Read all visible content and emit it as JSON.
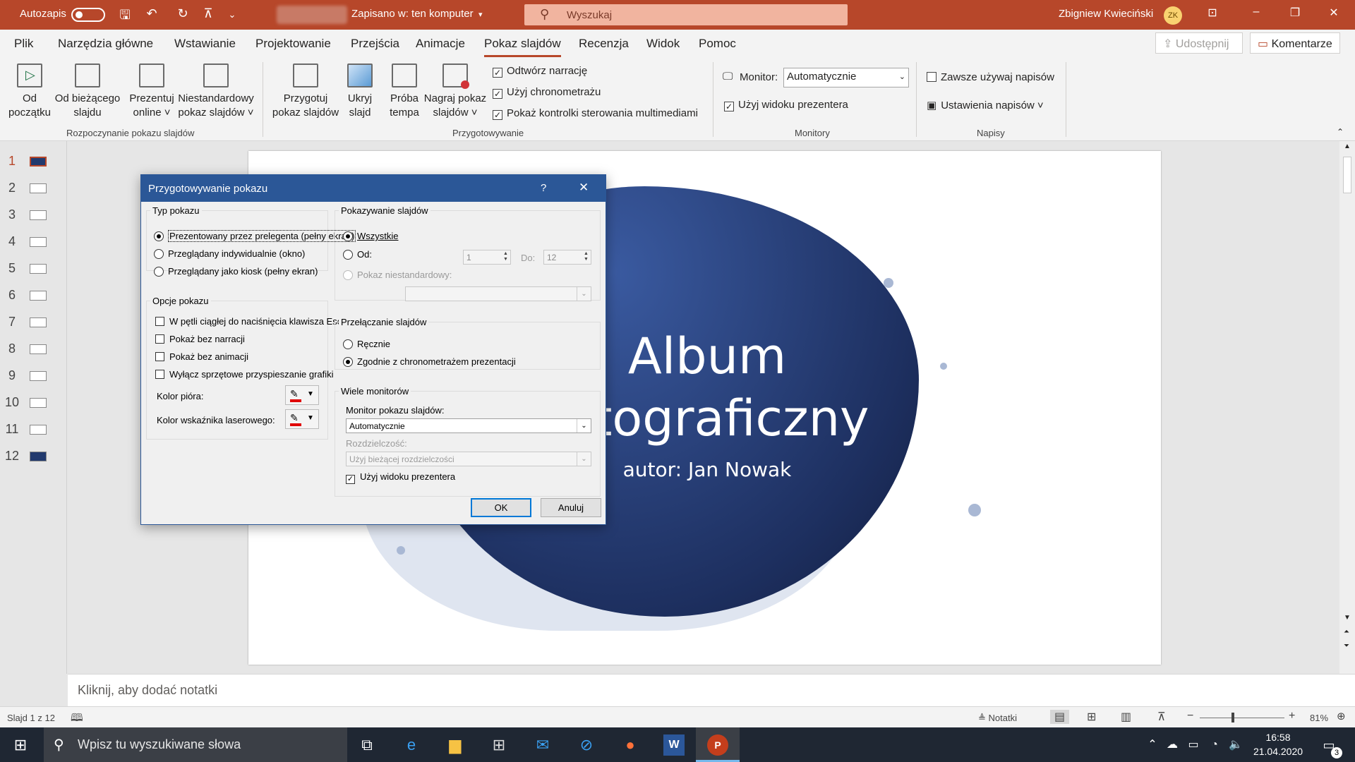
{
  "titlebar": {
    "autosave": "Autozapis",
    "save_state": "Zapisano w: ten komputer",
    "search_placeholder": "Wyszukaj",
    "user": "Zbigniew Kwieciński",
    "initials": "ZK"
  },
  "tabs": [
    "Plik",
    "Narzędzia główne",
    "Wstawianie",
    "Projektowanie",
    "Przejścia",
    "Animacje",
    "Pokaz slajdów",
    "Recenzja",
    "Widok",
    "Pomoc"
  ],
  "share_label": "Udostępnij",
  "comments_label": "Komentarze",
  "ribbon": {
    "from_start": [
      "Od",
      "początku"
    ],
    "from_current": [
      "Od bieżącego",
      "slajdu"
    ],
    "present_online": [
      "Prezentuj",
      "online ˅"
    ],
    "custom_show": [
      "Niestandardowy",
      "pokaz slajdów ˅"
    ],
    "group_start": "Rozpoczynanie pokazu slajdów",
    "setup_show": [
      "Przygotuj",
      "pokaz slajdów"
    ],
    "hide_slide": [
      "Ukryj",
      "slajd"
    ],
    "rehearse": [
      "Próba",
      "tempa"
    ],
    "record": [
      "Nagraj pokaz",
      "slajdów ˅"
    ],
    "play_narrations": "Odtwórz narrację",
    "use_timings": "Użyj chronometrażu",
    "show_media_controls": "Pokaż kontrolki sterowania multimediami",
    "group_setup": "Przygotowywanie",
    "monitor_label": "Monitor:",
    "monitor_value": "Automatycznie",
    "presenter_view": "Użyj widoku prezentera",
    "group_monitors": "Monitory",
    "always_subtitles": "Zawsze używaj napisów",
    "subtitle_settings": "Ustawienia napisów ˅",
    "group_captions": "Napisy"
  },
  "thumbnails": [
    "1",
    "2",
    "3",
    "4",
    "5",
    "6",
    "7",
    "8",
    "9",
    "10",
    "11",
    "12"
  ],
  "slide": {
    "title_line1": "Album",
    "title_line2": "fotograficzny",
    "subtitle": "autor: Jan Nowak"
  },
  "notes_placeholder": "Kliknij, aby dodać notatki",
  "status": {
    "slide_count": "Slajd 1 z 12",
    "notes": "Notatki",
    "zoom": "81%"
  },
  "taskbar": {
    "search": "Wpisz tu wyszukiwane słowa",
    "time": "16:58",
    "date": "21.04.2020",
    "notification_count": "3"
  },
  "dialog": {
    "title": "Przygotowywanie pokazu",
    "help": "?",
    "show_type_legend": "Typ pokazu",
    "type_presenter": "Prezentowany przez prelegenta (pełny ekran)",
    "type_individual": "Przeglądany indywidualnie (okno)",
    "type_kiosk": "Przeglądany jako kiosk (pełny ekran)",
    "show_options_legend": "Opcje pokazu",
    "loop": "W pętli ciągłej do naciśnięcia klawisza Esc",
    "no_narration": "Pokaż bez narracji",
    "no_animation": "Pokaż bez animacji",
    "disable_hw": "Wyłącz sprzętowe przyspieszanie grafiki",
    "pen_color": "Kolor pióra:",
    "laser_color": "Kolor wskaźnika laserowego:",
    "show_slides_legend": "Pokazywanie slajdów",
    "all": "Wszystkie",
    "from": "Od:",
    "from_value": "1",
    "to": "Do:",
    "to_value": "12",
    "custom_show": "Pokaz niestandardowy:",
    "advance_legend": "Przełączanie slajdów",
    "manually": "Ręcznie",
    "using_timings": "Zgodnie z chronometrażem prezentacji",
    "monitors_legend": "Wiele monitorów",
    "slide_monitor": "Monitor pokazu slajdów:",
    "slide_monitor_value": "Automatycznie",
    "resolution": "Rozdzielczość:",
    "resolution_value": "Użyj bieżącej rozdzielczości",
    "presenter_view": "Użyj widoku prezentera",
    "ok": "OK",
    "cancel": "Anuluj",
    "pen_color_hex": "#e00000"
  }
}
